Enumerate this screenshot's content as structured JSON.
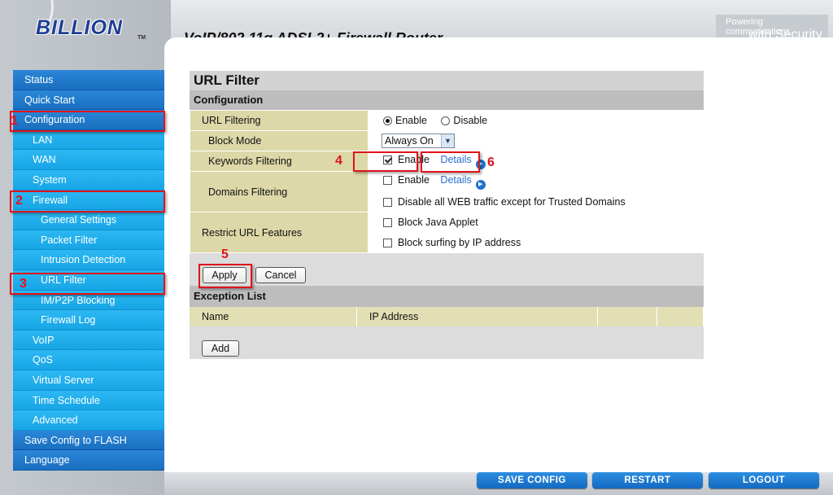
{
  "header": {
    "logo": "BILLION",
    "trademark": "TM",
    "product_title": "VoIP/802.11g ADSL2+ Firewall Router",
    "tagline_1": "Powering communications",
    "tagline_2": "with Security"
  },
  "sidebar": {
    "items": [
      {
        "label": "Status",
        "level": 1
      },
      {
        "label": "Quick Start",
        "level": 1
      },
      {
        "label": "Configuration",
        "level": 1
      },
      {
        "label": "LAN",
        "level": 2
      },
      {
        "label": "WAN",
        "level": 2
      },
      {
        "label": "System",
        "level": 2
      },
      {
        "label": "Firewall",
        "level": 2
      },
      {
        "label": "General Settings",
        "level": 3
      },
      {
        "label": "Packet Filter",
        "level": 3
      },
      {
        "label": "Intrusion Detection",
        "level": 3
      },
      {
        "label": "URL Filter",
        "level": 3
      },
      {
        "label": "IM/P2P Blocking",
        "level": 3
      },
      {
        "label": "Firewall Log",
        "level": 3
      },
      {
        "label": "VoIP",
        "level": 2
      },
      {
        "label": "QoS",
        "level": 2
      },
      {
        "label": "Virtual Server",
        "level": 2
      },
      {
        "label": "Time Schedule",
        "level": 2
      },
      {
        "label": "Advanced",
        "level": 2
      },
      {
        "label": "Save Config to FLASH",
        "level": 1
      },
      {
        "label": "Language",
        "level": 1
      }
    ]
  },
  "page": {
    "title": "URL Filter",
    "config_header": "Configuration",
    "url_filtering": {
      "label": "URL Filtering",
      "enable": "Enable",
      "disable": "Disable",
      "selected": "Enable"
    },
    "block_mode": {
      "label": "Block Mode",
      "value": "Always On"
    },
    "keywords": {
      "label": "Keywords Filtering",
      "enable": "Enable",
      "checked": true,
      "details": "Details"
    },
    "domains": {
      "label": "Domains Filtering",
      "enable": "Enable",
      "enable_checked": false,
      "details": "Details",
      "disable_all": "Disable all WEB traffic except for Trusted Domains",
      "disable_all_checked": false
    },
    "restrict": {
      "label": "Restrict URL Features",
      "java": "Block Java Applet",
      "java_checked": false,
      "ip": "Block surfing by IP address",
      "ip_checked": false
    },
    "apply": "Apply",
    "cancel": "Cancel",
    "exception_header": "Exception List",
    "exception_cols": [
      "Name",
      "IP Address",
      "",
      ""
    ],
    "add": "Add"
  },
  "annotations": [
    "1",
    "2",
    "3",
    "4",
    "5",
    "6"
  ],
  "footer": {
    "save": "SAVE CONFIG",
    "restart": "RESTART",
    "logout": "LOGOUT"
  },
  "colors": {
    "annotation": "#e0131c",
    "nav_primary": "#1a6fc0",
    "nav_secondary": "#17a5e6",
    "label_bg": "#dcd8a8"
  }
}
